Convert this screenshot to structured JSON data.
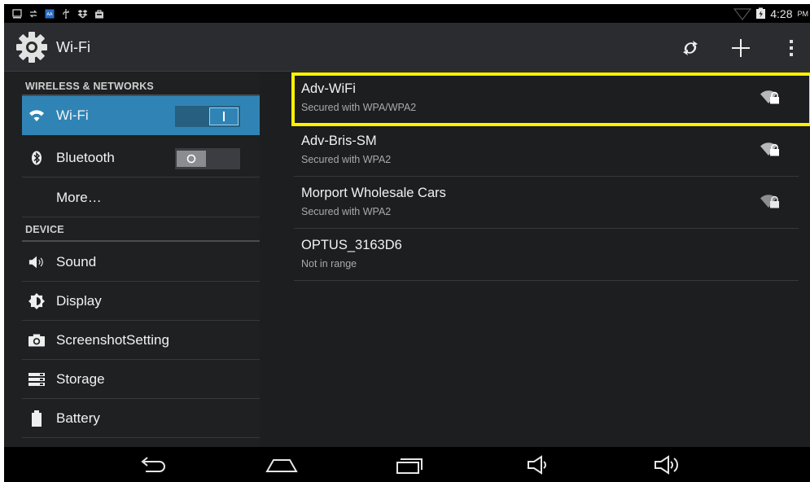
{
  "status_bar": {
    "time": "4:28",
    "ampm": "PM",
    "icons": [
      "screenshot-icon",
      "sync-icon",
      "app-icon",
      "usb-icon",
      "dropbox-icon",
      "bag-icon",
      "signal-icon",
      "battery-icon"
    ]
  },
  "action_bar": {
    "title": "Wi-Fi",
    "actions": [
      "wps-icon",
      "add-network-icon",
      "overflow-menu-icon"
    ]
  },
  "sidebar": {
    "sections": [
      {
        "header": "WIRELESS & NETWORKS",
        "items": [
          {
            "label": "Wi-Fi",
            "icon": "wifi-icon",
            "toggle": "on",
            "selected": true
          },
          {
            "label": "Bluetooth",
            "icon": "bluetooth-icon",
            "toggle": "off",
            "selected": false
          },
          {
            "label": "More…",
            "icon": "",
            "selected": false
          }
        ]
      },
      {
        "header": "DEVICE",
        "items": [
          {
            "label": "Sound",
            "icon": "speaker-icon"
          },
          {
            "label": "Display",
            "icon": "brightness-icon"
          },
          {
            "label": "ScreenshotSetting",
            "icon": "camera-icon"
          },
          {
            "label": "Storage",
            "icon": "storage-icon"
          },
          {
            "label": "Battery",
            "icon": "battery-icon"
          }
        ]
      }
    ]
  },
  "networks": [
    {
      "name": "Adv-WiFi",
      "status": "Secured with WPA/WPA2",
      "secured": true,
      "highlighted": true
    },
    {
      "name": "Adv-Bris-SM",
      "status": "Secured with WPA2",
      "secured": true
    },
    {
      "name": "Morport Wholesale Cars",
      "status": "Secured with WPA2",
      "secured": true
    },
    {
      "name": "OPTUS_3163D6",
      "status": "Not in range",
      "secured": false
    }
  ],
  "navigation_bar": [
    "back-icon",
    "home-icon",
    "recents-icon",
    "volume-down-icon",
    "volume-up-icon"
  ],
  "colors": {
    "accent": "#2f84b5",
    "highlight": "#fff200",
    "background": "#1d1e20",
    "action_bar": "#2a2c2f"
  }
}
